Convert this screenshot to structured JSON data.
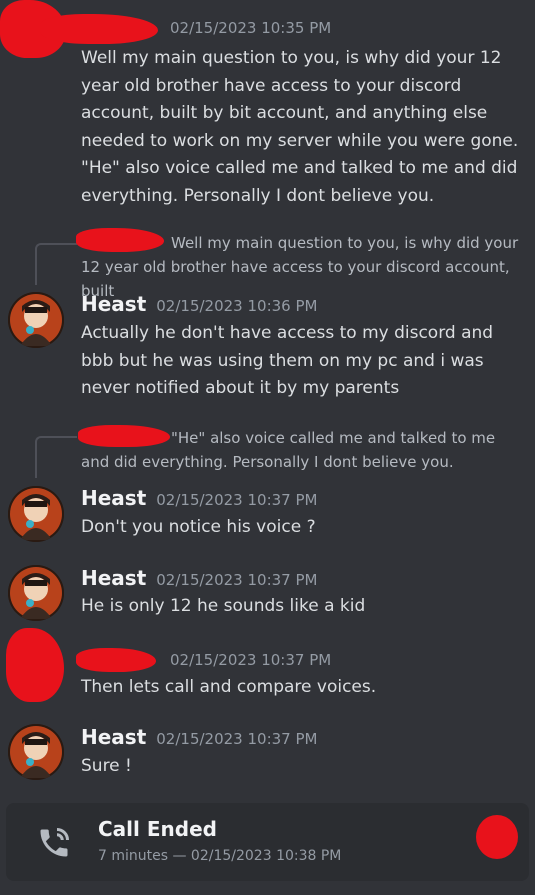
{
  "messages": [
    {
      "timestamp": "02/15/2023 10:35 PM",
      "lines": [
        "Well my main question to you, is why did your 12 year old brother have access to your discord account, built by bit account, and anything else needed to work on my server while you were gone.",
        "\"He\" also voice called me and talked to me and did everything. Personally I dont believe you."
      ]
    },
    {
      "reply_text": "Well my main question to you, is why did your 12 year old brother have access to your discord account, built",
      "author": "Heast",
      "timestamp": "02/15/2023 10:36 PM",
      "text": "Actually he don't have access to my discord and bbb but he was using them on my pc and i was never notified about it by my parents"
    },
    {
      "reply_text": "\"He\" also voice called me and talked to me and did everything. Personally I dont believe you.",
      "author": "Heast",
      "timestamp": "02/15/2023 10:37 PM",
      "text": "Don't you notice his voice ?"
    },
    {
      "author": "Heast",
      "timestamp": "02/15/2023 10:37 PM",
      "text": "He is only 12 he sounds like a kid"
    },
    {
      "timestamp": "02/15/2023 10:37 PM",
      "text": "Then lets call and compare voices."
    },
    {
      "author": "Heast",
      "timestamp": "02/15/2023 10:37 PM",
      "text": "Sure !"
    }
  ],
  "call": {
    "title": "Call Ended",
    "subtitle": "7 minutes — 02/15/2023 10:38 PM",
    "icon": "phone-call-icon"
  },
  "colors": {
    "background": "#313338",
    "call_card": "#2b2d31",
    "redaction": "#e8121b"
  }
}
